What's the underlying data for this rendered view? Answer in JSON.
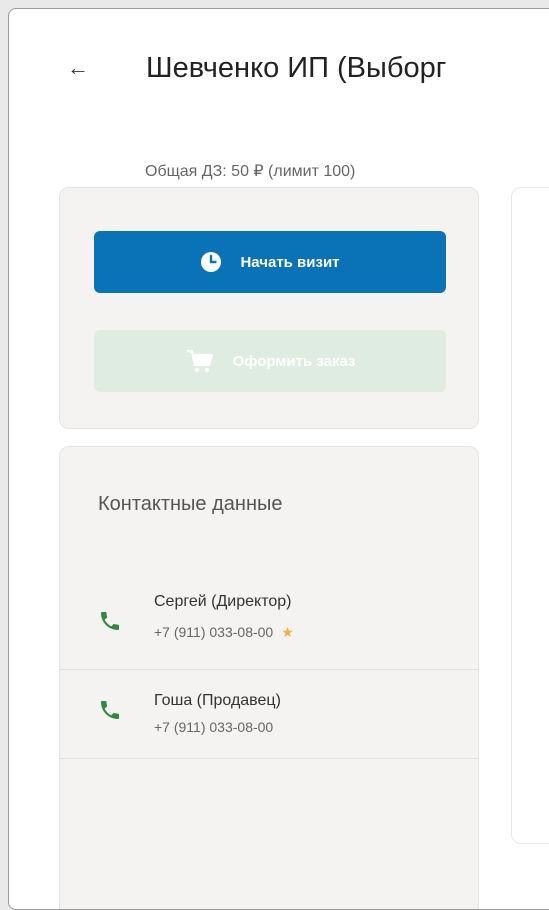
{
  "header": {
    "back_icon": "←",
    "title": "Шевченко ИП (Выборг",
    "debt": "Общая ДЗ: 50 ₽ (лимит 100)"
  },
  "actions": {
    "start_visit": "Начать визит",
    "place_order": "Оформить заказ"
  },
  "contacts": {
    "title": "Контактные данные",
    "items": [
      {
        "name": "Сергей (Директор)",
        "phone": "+7 (911) 033-08-00",
        "favorite": "★"
      },
      {
        "name": "Гоша (Продавец)",
        "phone": "+7 (911) 033-08-00"
      }
    ]
  },
  "colors": {
    "primary": "#0a72b6",
    "phone_icon": "#2e8b3e",
    "star": "#f2b233"
  }
}
